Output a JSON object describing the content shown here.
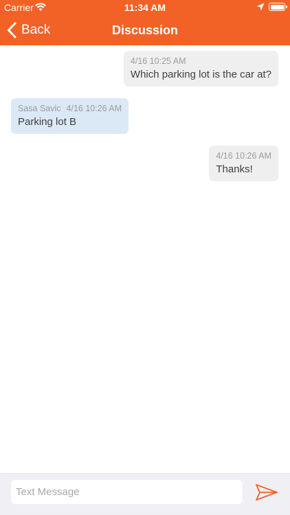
{
  "status_bar": {
    "carrier": "Carrier",
    "time": "11:34 AM"
  },
  "nav": {
    "back_label": "Back",
    "title": "Discussion"
  },
  "messages": [
    {
      "direction": "outgoing",
      "sender": "",
      "timestamp": "4/16 10:25 AM",
      "text": "Which parking lot is the car at?"
    },
    {
      "direction": "incoming",
      "sender": "Sasa Savic",
      "timestamp": "4/16 10:26 AM",
      "text": "Parking lot B"
    },
    {
      "direction": "outgoing",
      "sender": "",
      "timestamp": "4/16 10:26 AM",
      "text": "Thanks!"
    }
  ],
  "composer": {
    "placeholder": "Text Message",
    "value": ""
  },
  "colors": {
    "accent": "#f26226",
    "outgoing_bubble": "#efefef",
    "incoming_bubble": "#dbe9f7"
  },
  "icons": {
    "back": "chevron-left-icon",
    "send": "paper-plane-icon",
    "wifi": "wifi-icon",
    "location": "location-arrow-icon",
    "battery": "battery-icon"
  }
}
